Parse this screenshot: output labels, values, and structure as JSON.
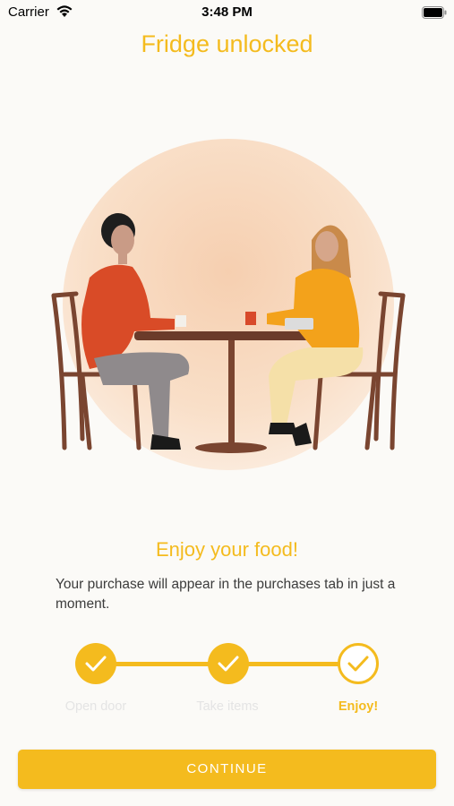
{
  "status_bar": {
    "carrier": "Carrier",
    "time": "3:48 PM",
    "wifi_icon": "wifi-icon",
    "battery_icon": "battery-icon"
  },
  "header": {
    "title": "Fridge unlocked"
  },
  "illustration": {
    "icon": "people-at-table-illustration"
  },
  "content": {
    "subtitle": "Enjoy your food!",
    "description": "Your purchase will appear in the purchases tab in just a moment."
  },
  "stepper": {
    "steps": [
      {
        "label": "Open door",
        "state": "done"
      },
      {
        "label": "Take items",
        "state": "done"
      },
      {
        "label": "Enjoy!",
        "state": "current"
      }
    ],
    "check_icon": "checkmark-icon"
  },
  "footer": {
    "continue_label": "CONTINUE"
  },
  "colors": {
    "accent": "#f4bb1e",
    "background": "#fbfaf7",
    "text": "#3c3c3c",
    "inactive": "#e4e4e4"
  }
}
